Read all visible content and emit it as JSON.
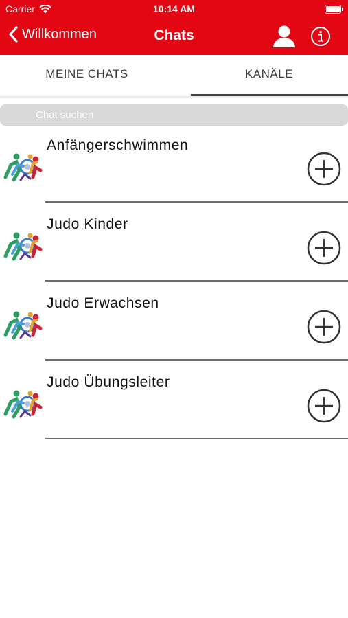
{
  "status_bar": {
    "carrier": "Carrier",
    "time": "10:14 AM"
  },
  "navbar": {
    "back_label": "Willkommen",
    "title": "Chats"
  },
  "tabs": [
    {
      "label": "MEINE CHATS",
      "selected": false
    },
    {
      "label": "KANÄLE",
      "selected": true
    }
  ],
  "search": {
    "placeholder": "Chat suchen",
    "value": ""
  },
  "channels": [
    {
      "name": "Anfängerschwimmen"
    },
    {
      "name": "Judo Kinder"
    },
    {
      "name": "Judo Erwachsen"
    },
    {
      "name": "Judo Übungsleiter"
    }
  ],
  "colors": {
    "accent": "#e30613",
    "divider": "#6c6c6c",
    "search_bg": "#d9d9d9",
    "tab_indicator": "#444444"
  }
}
